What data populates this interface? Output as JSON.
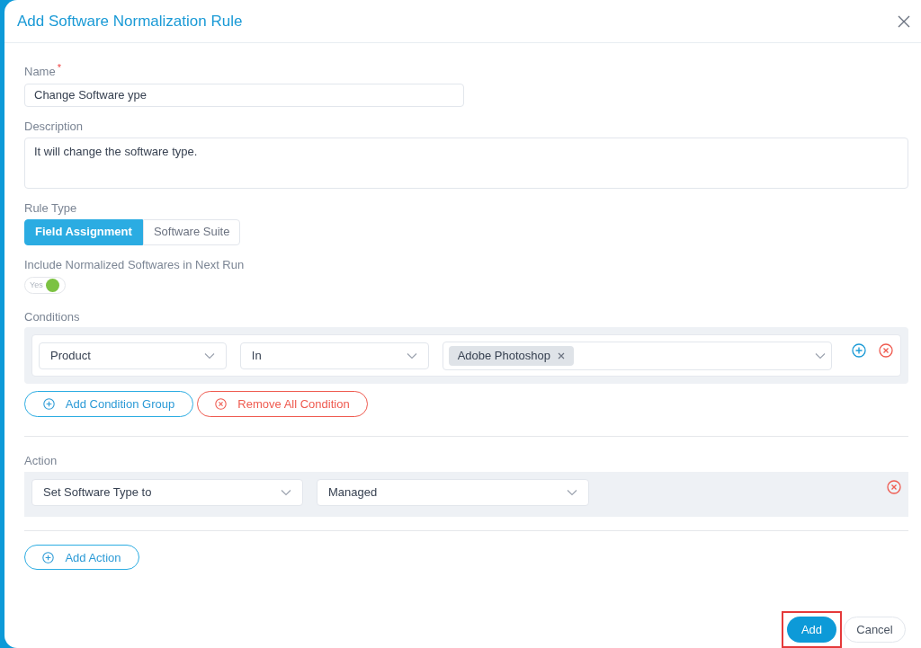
{
  "dialog": {
    "title": "Add Software Normalization Rule"
  },
  "name_field": {
    "label": "Name",
    "required": true,
    "required_mark": "*",
    "value": "Change Software ype"
  },
  "description_field": {
    "label": "Description",
    "value": "It will change the software type."
  },
  "rule_type": {
    "label": "Rule Type",
    "options": [
      {
        "label": "Field Assignment",
        "selected": true
      },
      {
        "label": "Software Suite",
        "selected": false
      }
    ]
  },
  "include_toggle": {
    "label": "Include Normalized Softwares in Next Run",
    "on": true,
    "state_text": "Yes"
  },
  "conditions": {
    "label": "Conditions",
    "row": {
      "field": "Product",
      "operator": "In",
      "tags": [
        "Adobe Photoshop"
      ]
    },
    "add_group_button": "Add Condition Group",
    "remove_all_button": "Remove All Condition"
  },
  "action": {
    "label": "Action",
    "field": "Set Software Type to",
    "value": "Managed",
    "add_button": "Add Action"
  },
  "footer": {
    "primary": {
      "label": "Add",
      "highlighted": true
    },
    "secondary": "Cancel"
  }
}
